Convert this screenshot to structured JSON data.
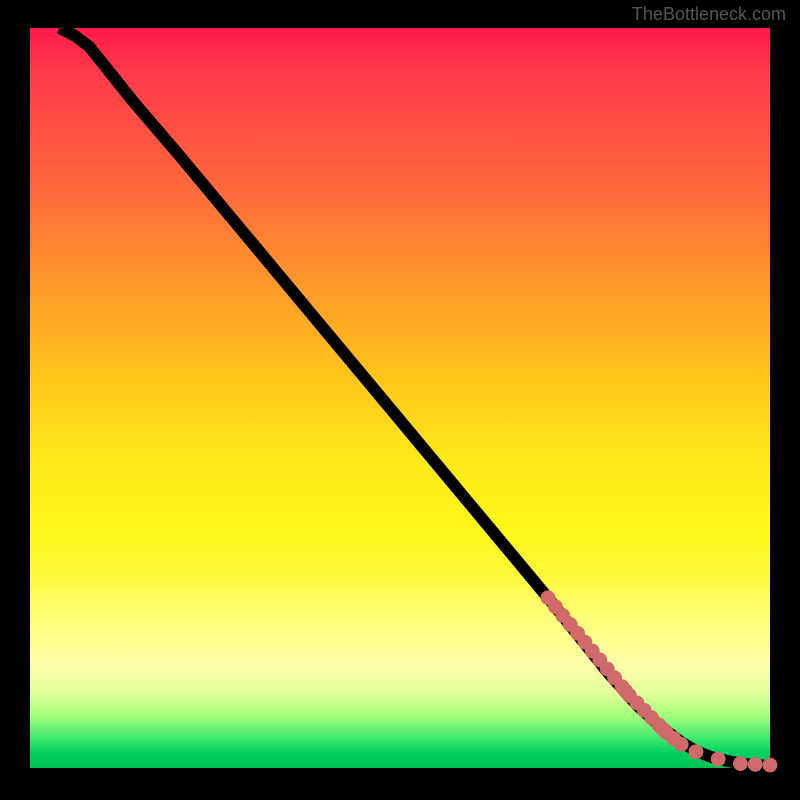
{
  "watermark": "TheBottleneck.com",
  "chart_data": {
    "type": "line",
    "xlim": [
      0,
      100
    ],
    "ylim": [
      0,
      100
    ],
    "title": "",
    "xlabel": "",
    "ylabel": "",
    "series": [
      {
        "name": "curve",
        "x": [
          4,
          6,
          8,
          10,
          14,
          20,
          30,
          40,
          50,
          60,
          70,
          78,
          82,
          85,
          88,
          90,
          92,
          94,
          96,
          98,
          100
        ],
        "y": [
          100,
          99,
          97.5,
          95,
          90,
          83,
          71,
          59,
          47,
          35,
          23,
          13,
          8.5,
          5.8,
          3.5,
          2.3,
          1.5,
          1.0,
          0.6,
          0.4,
          0.3
        ]
      }
    ],
    "markers": {
      "name": "points",
      "color": "#d06a6a",
      "x": [
        70,
        71,
        72,
        73,
        74,
        75,
        76,
        77,
        78,
        79,
        80,
        80.5,
        81,
        82,
        83,
        84,
        85,
        85.5,
        86,
        87,
        88,
        90,
        93,
        96,
        98,
        100
      ],
      "y": [
        23,
        21.8,
        20.6,
        19.4,
        18.2,
        17,
        15.8,
        14.6,
        13.4,
        12.2,
        11,
        10.4,
        9.8,
        8.8,
        7.8,
        6.8,
        5.8,
        5.3,
        4.8,
        4.0,
        3.2,
        2.2,
        1.2,
        0.6,
        0.5,
        0.4
      ]
    }
  }
}
